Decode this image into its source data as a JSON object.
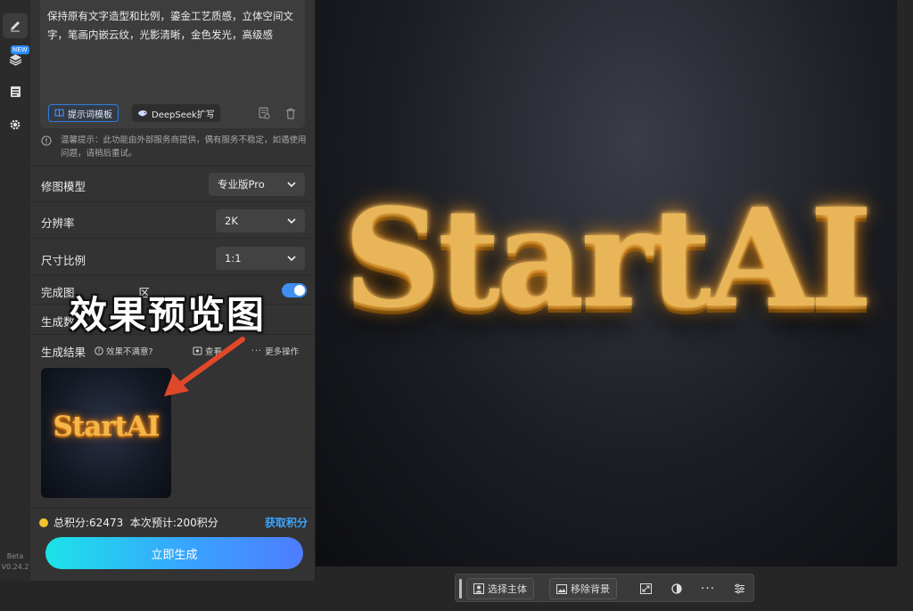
{
  "sidebar": {
    "tools": [
      {
        "icon": "pen-icon",
        "active": true
      },
      {
        "icon": "layers-icon",
        "badge": "NEW"
      },
      {
        "icon": "document-icon"
      },
      {
        "icon": "gear-icon"
      }
    ],
    "version_label": "Beta",
    "version": "V0.24.2"
  },
  "prompt": {
    "text": "保持原有文字造型和比例，鎏金工艺质感，立体空间文字，笔画内嵌云纹，光影清晰，金色发光，高级感",
    "template_button": "提示词模板",
    "deepseek_button": "DeepSeek扩写"
  },
  "tip": "温馨提示：此功能由外部服务商提供，偶有服务不稳定，如遇使用问题，请稍后重试。",
  "settings": {
    "model_label": "修图模型",
    "model_value": "专业版Pro",
    "resolution_label": "分辨率",
    "resolution_value": "2K",
    "ratio_label": "尺寸比例",
    "ratio_value": "1:1",
    "complete_label": "完成图",
    "complete_tail": "区",
    "count_label": "生成数"
  },
  "results": {
    "title": "生成结果",
    "dissatisfied": "效果不满意?",
    "view": "查看",
    "more": "更多操作",
    "thumb_text": "StartAI"
  },
  "credits": {
    "text": "总积分:62473  本次预计:200积分",
    "get": "获取积分"
  },
  "generate_button": "立即生成",
  "canvas": {
    "hero_text": "StartAI"
  },
  "annotation": {
    "text": "效果预览图",
    "arrow_color": "#e0482a"
  },
  "bottom_toolbar": {
    "select_subject": "选择主体",
    "remove_bg": "移除背景"
  },
  "colors": {
    "accent": "#2f7ee0",
    "link": "#3aa6ff",
    "gold": "#e8b659"
  }
}
